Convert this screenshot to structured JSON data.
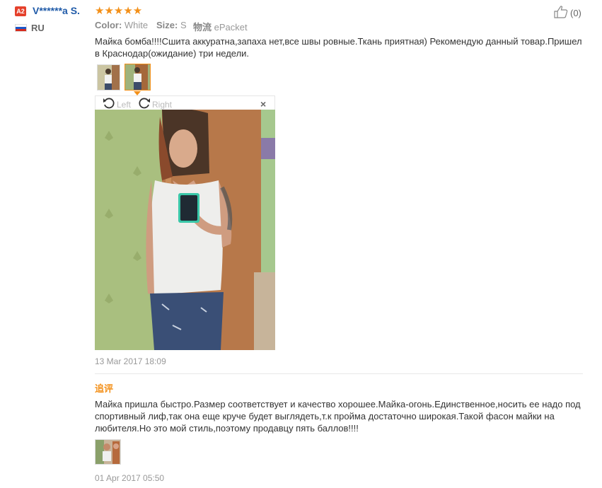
{
  "reviewer": {
    "badge": "A2",
    "name": "V******a S.",
    "stars": "★★★★★",
    "country": "RU",
    "flag_colors": [
      "#ffffff",
      "#1c57c9",
      "#d52b1e"
    ]
  },
  "meta": {
    "color_label": "Color:",
    "color_value": "White",
    "size_label": "Size:",
    "size_value": "S",
    "shipping_label": "物流",
    "shipping_value": "ePacket"
  },
  "likes": {
    "count": "(0)",
    "icon": "thumbs-up-icon"
  },
  "review": {
    "text": "Майка бомба!!!!Сшита аккуратна,запаха нет,все швы ровные.Ткань приятная) Рекомендую данный товар.Пришел в Краснодар(ожидание) три недели.",
    "date": "13 Mar 2017 18:09"
  },
  "viewer": {
    "left_label": "Left",
    "right_label": "Right",
    "close": "×"
  },
  "additional": {
    "label": "追评",
    "text": "Майка пришла быстро.Размер соответствует и качество хорошее.Майка-огонь.Единственное,носить ее надо под спортивный лиф,так она еще круче будет выглядеть,т.к пройма достаточно широкая.Такой фасон майки на любителя.Но это мой стиль,поэтому продавцу пять баллов!!!!",
    "date": "01 Apr 2017 05:50"
  },
  "colors": {
    "accent": "#f39019",
    "name_blue": "#1f5aa8",
    "badge_red": "#e5412c"
  }
}
